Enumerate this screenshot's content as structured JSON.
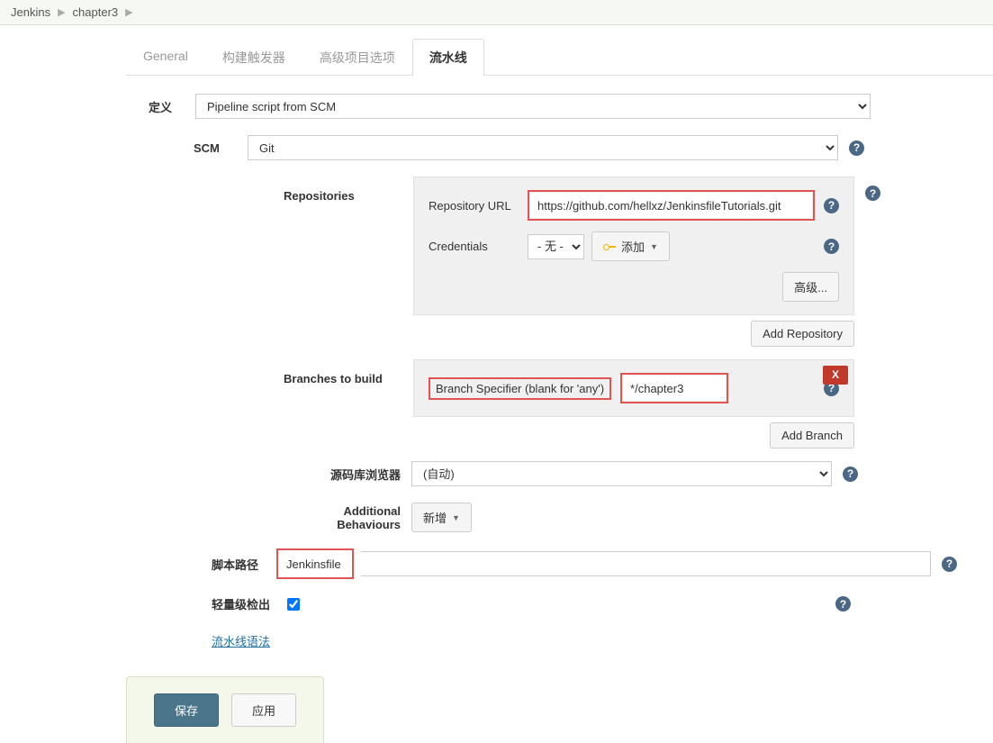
{
  "breadcrumb": {
    "items": [
      "Jenkins",
      "chapter3"
    ]
  },
  "tabs": {
    "general": "General",
    "triggers": "构建触发器",
    "advanced": "高级项目选项",
    "pipeline": "流水线"
  },
  "labels": {
    "definition": "定义",
    "scm": "SCM",
    "repositories": "Repositories",
    "repo_url": "Repository URL",
    "credentials": "Credentials",
    "branches": "Branches to build",
    "branch_specifier": "Branch Specifier (blank for 'any')",
    "repo_browser": "源码库浏览器",
    "additional_behaviours": "Additional Behaviours",
    "script_path": "脚本路径",
    "lightweight": "轻量级检出",
    "pipeline_syntax": "流水线语法"
  },
  "values": {
    "definition": "Pipeline script from SCM",
    "scm": "Git",
    "repo_url": "https://github.com/hellxz/JenkinsfileTutorials.git",
    "credentials_none": "- 无 -",
    "branch_specifier": "*/chapter3",
    "repo_browser": "(自动)",
    "script_path": "Jenkinsfile",
    "lightweight_checked": true
  },
  "buttons": {
    "add_cred": "添加",
    "advanced": "高级...",
    "add_repository": "Add Repository",
    "add_branch": "Add Branch",
    "add_behaviour": "新增",
    "delete": "X",
    "save": "保存",
    "apply": "应用"
  }
}
